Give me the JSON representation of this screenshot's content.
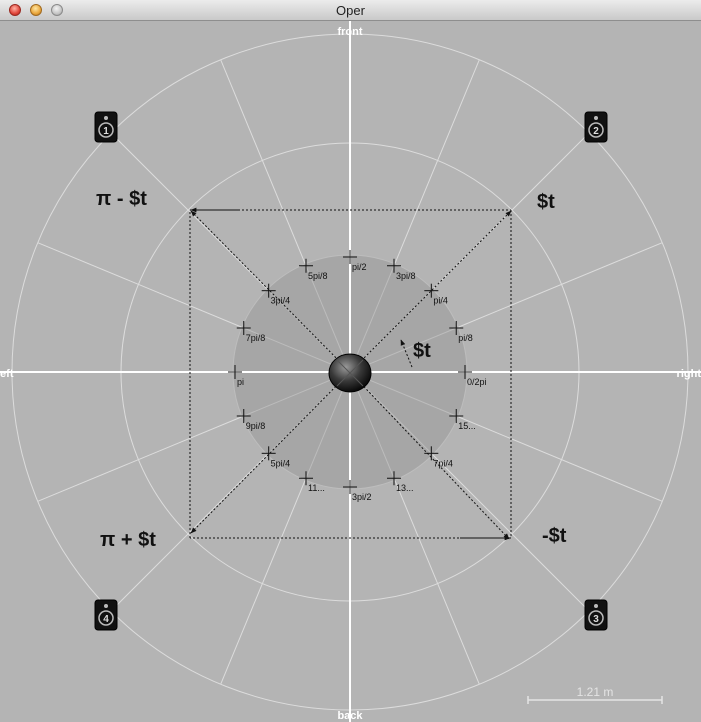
{
  "window": {
    "title": "Oper"
  },
  "directions": {
    "front": "front",
    "back": "back",
    "left": "left",
    "right": "right"
  },
  "angle_labels": {
    "t": "$t",
    "pi_minus_t": "π - $t",
    "pi_plus_t": "π + $t",
    "neg_t": "-$t",
    "center_t": "$t"
  },
  "markers": [
    "pi/2",
    "3pi/8",
    "pi/4",
    "pi/8",
    "0/2pi",
    "15...",
    "7pi/4",
    "13...",
    "3pi/2",
    "11...",
    "5pi/4",
    "9pi/8",
    "pi",
    "7pi/8",
    "3pi/4",
    "5pi/8"
  ],
  "speakers": [
    {
      "number": "1",
      "icon": "speaker-icon"
    },
    {
      "number": "2",
      "icon": "speaker-icon"
    },
    {
      "number": "3",
      "icon": "speaker-icon"
    },
    {
      "number": "4",
      "icon": "speaker-icon"
    }
  ],
  "scale": {
    "label": "1.21 m"
  },
  "colors": {
    "background": "#b4b4b4",
    "inner_disc": "#a5a5a5",
    "grid": "#dcdcdc",
    "axis": "#ffffff"
  }
}
